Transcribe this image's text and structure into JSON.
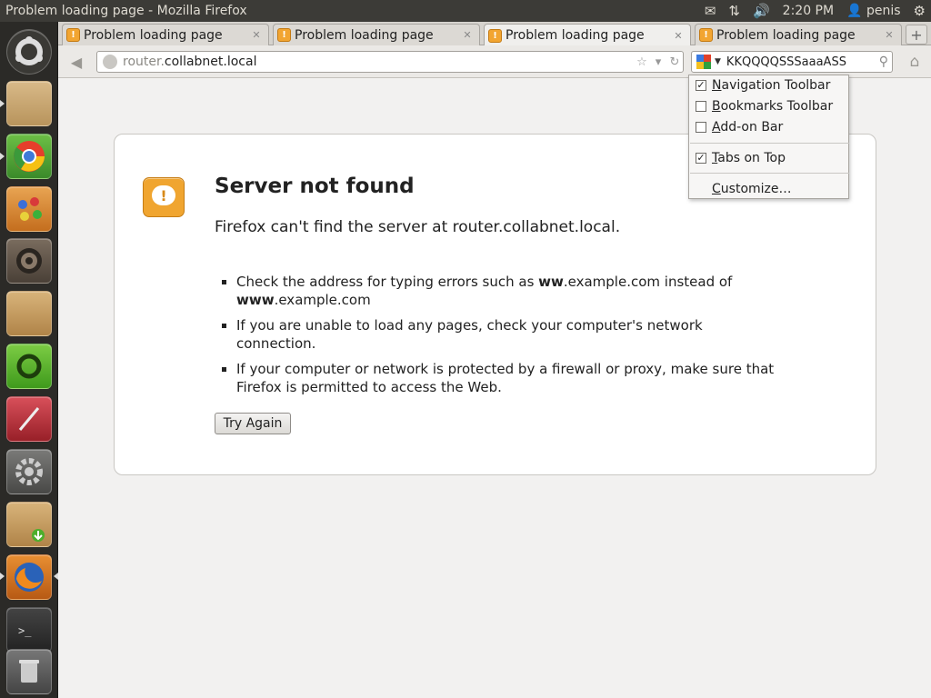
{
  "panel": {
    "window_title": "Problem loading page - Mozilla Firefox",
    "time": "2:20 PM",
    "user": "penis"
  },
  "tabs": [
    {
      "label": "Problem loading page",
      "active": false
    },
    {
      "label": "Problem loading page",
      "active": false
    },
    {
      "label": "Problem loading page",
      "active": true
    },
    {
      "label": "Problem loading page",
      "active": false
    }
  ],
  "nav": {
    "url_prefix": "router.",
    "url_domain": "collabnet.local",
    "search_value": "KKQQQQSSSaaaASS"
  },
  "context_menu": {
    "items": [
      {
        "pre": "",
        "accel": "N",
        "post": "avigation Toolbar",
        "checked": true
      },
      {
        "pre": "",
        "accel": "B",
        "post": "ookmarks Toolbar",
        "checked": false
      },
      {
        "pre": "",
        "accel": "A",
        "post": "dd-on Bar",
        "checked": false
      },
      {
        "pre": "",
        "accel": "T",
        "post": "abs on Top",
        "checked": true
      },
      {
        "pre": "",
        "accel": "C",
        "post": "ustomize…",
        "checked": null
      }
    ]
  },
  "error_page": {
    "title": "Server not found",
    "description": "Firefox can't find the server at router.collabnet.local.",
    "bullet1_a": "Check the address for typing errors such as ",
    "bullet1_b": "ww",
    "bullet1_c": ".example.com instead of ",
    "bullet1_d": "www",
    "bullet1_e": ".example.com",
    "bullet2": "If you are unable to load any pages, check your computer's network connection.",
    "bullet3": "If your computer or network is protected by a firewall or proxy, make sure that Firefox is permitted to access the Web.",
    "try_again": "Try Again"
  },
  "launcher": [
    {
      "name": "dash-home-icon",
      "color": "#3a3935"
    },
    {
      "name": "files-icon",
      "color": "#c9a46a"
    },
    {
      "name": "chrome-icon",
      "color": "#3b8a2a"
    },
    {
      "name": "paint-icon",
      "color": "#d98a2c"
    },
    {
      "name": "speaker-icon",
      "color": "#5a4f44"
    },
    {
      "name": "package-icon",
      "color": "#c39a5e"
    },
    {
      "name": "ubuntu-one-icon",
      "color": "#5bb02a"
    },
    {
      "name": "magic-wand-icon",
      "color": "#b8323c"
    },
    {
      "name": "settings-icon",
      "color": "#5e5e5c"
    },
    {
      "name": "download-package-icon",
      "color": "#c9a05a"
    },
    {
      "name": "firefox-icon",
      "color": "#e2892a"
    },
    {
      "name": "terminal-icon",
      "color": "#2f2f2d"
    },
    {
      "name": "trash-icon",
      "color": "#5e5e5c"
    }
  ]
}
